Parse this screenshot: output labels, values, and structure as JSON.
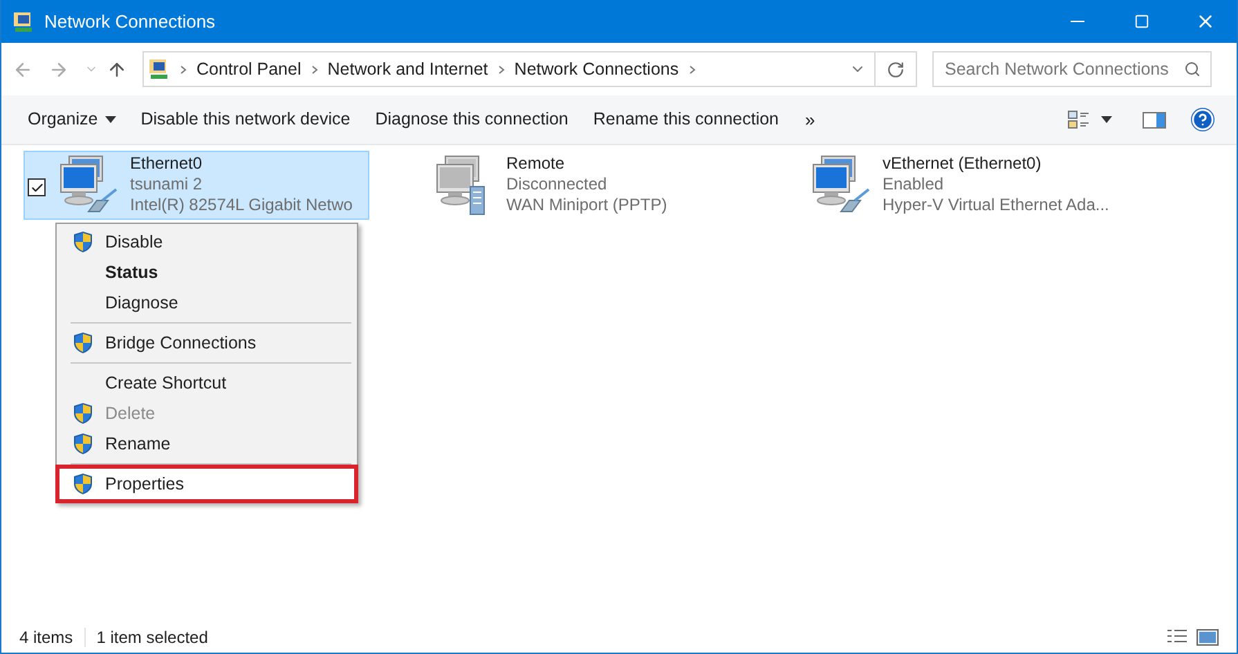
{
  "window": {
    "title": "Network Connections"
  },
  "address": {
    "path": [
      "Control Panel",
      "Network and Internet",
      "Network Connections"
    ]
  },
  "search": {
    "placeholder": "Search Network Connections"
  },
  "commands": [
    "Organize",
    "Disable this network device",
    "Diagnose this connection",
    "Rename this connection"
  ],
  "more": "»",
  "connections": [
    {
      "name": "Ethernet0",
      "status": "tsunami 2",
      "device": "Intel(R) 82574L Gigabit Netwo",
      "kind": "ethernet",
      "enabled": true,
      "selected": true
    },
    {
      "name": "Remote",
      "status": "Disconnected",
      "device": "WAN Miniport (PPTP)",
      "kind": "wan",
      "enabled": false,
      "selected": false
    },
    {
      "name": "vEthernet (Ethernet0)",
      "status": "Enabled",
      "device": "Hyper-V Virtual Ethernet Ada...",
      "kind": "ethernet",
      "enabled": true,
      "selected": false
    }
  ],
  "context_menu": [
    {
      "kind": "item",
      "label": "Disable",
      "shield": true,
      "bold": false,
      "disabled": false,
      "highlighted": false
    },
    {
      "kind": "item",
      "label": "Status",
      "shield": false,
      "bold": true,
      "disabled": false,
      "highlighted": false
    },
    {
      "kind": "item",
      "label": "Diagnose",
      "shield": false,
      "bold": false,
      "disabled": false,
      "highlighted": false
    },
    {
      "kind": "separator"
    },
    {
      "kind": "item",
      "label": "Bridge Connections",
      "shield": true,
      "bold": false,
      "disabled": false,
      "highlighted": false
    },
    {
      "kind": "separator"
    },
    {
      "kind": "item",
      "label": "Create Shortcut",
      "shield": false,
      "bold": false,
      "disabled": false,
      "highlighted": false
    },
    {
      "kind": "item",
      "label": "Delete",
      "shield": true,
      "bold": false,
      "disabled": true,
      "highlighted": false
    },
    {
      "kind": "item",
      "label": "Rename",
      "shield": true,
      "bold": false,
      "disabled": false,
      "highlighted": false
    },
    {
      "kind": "separator"
    },
    {
      "kind": "item",
      "label": "Properties",
      "shield": true,
      "bold": false,
      "disabled": false,
      "highlighted": true
    }
  ],
  "status_bar": {
    "count": "4 items",
    "selection": "1 item selected"
  }
}
